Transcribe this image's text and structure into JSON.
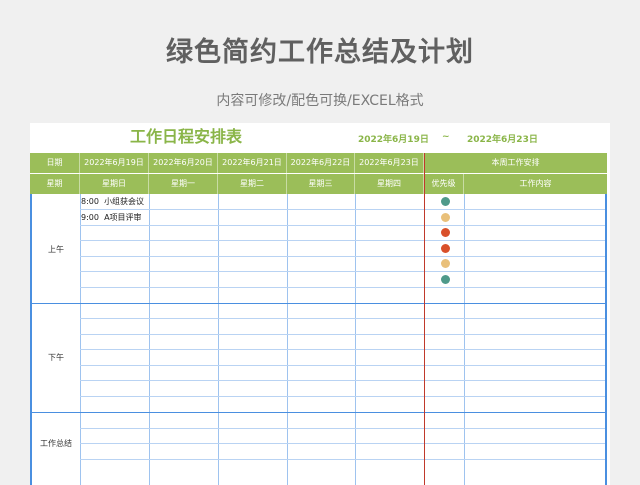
{
  "page": {
    "title": "绿色简约工作总结及计划",
    "subtitle": "内容可修改/配色可换/EXCEL格式"
  },
  "sheet": {
    "title": "工作日程安排表",
    "date_start": "2022年6月19日",
    "date_sep": "~",
    "date_end": "2022年6月23日",
    "header_row1": {
      "label": "日期",
      "dates": [
        "2022年6月19日",
        "2022年6月20日",
        "2022年6月21日",
        "2022年6月22日",
        "2022年6月23日"
      ],
      "week_plan": "本周工作安排"
    },
    "header_row2": {
      "label": "星期",
      "weekdays": [
        "星期日",
        "星期一",
        "星期二",
        "星期三",
        "星期四"
      ],
      "priority": "优先级",
      "content": "工作内容"
    },
    "sections": {
      "morning": "上午",
      "afternoon": "下午",
      "summary": "工作总结"
    },
    "entries": [
      {
        "time": "8:00",
        "text": "小组获会议"
      },
      {
        "time": "9:00",
        "text": "A项目评审"
      }
    ],
    "priority_colors": [
      "#4f9a8a",
      "#e9c07a",
      "#d9502a",
      "#d9502a",
      "#e9c07a",
      "#4f9a8a"
    ]
  }
}
